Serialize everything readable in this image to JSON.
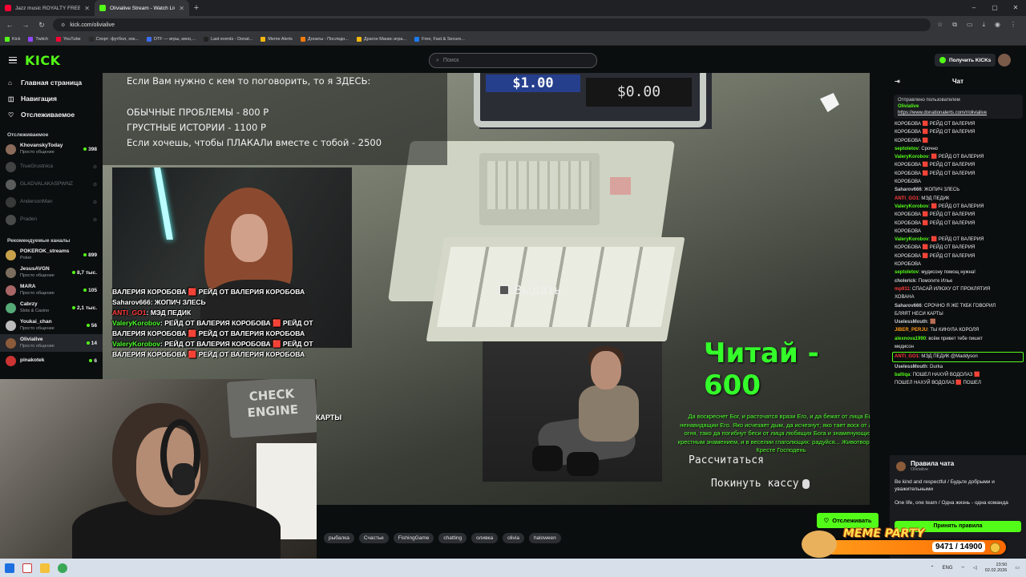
{
  "browser": {
    "tabs": [
      {
        "title": "Jazz music ROYALTY FREE Backg...",
        "color": "#ff0033",
        "active": false
      },
      {
        "title": "Olivialive Stream - Watch Live o...",
        "color": "#53fc18",
        "active": true
      }
    ],
    "new_tab": "+",
    "window_controls": [
      "–",
      "▢",
      "✕"
    ],
    "url": "kick.com/olivialive",
    "bookmarks": [
      {
        "label": "Kick",
        "color": "#53fc18"
      },
      {
        "label": "Twitch",
        "color": "#9146ff"
      },
      {
        "label": "YouTube",
        "color": "#ff0033"
      },
      {
        "label": "Спорт: футбол, хок...",
        "color": "#2a2a2a"
      },
      {
        "label": "DTF — игры, кино,...",
        "color": "#3b6df0"
      },
      {
        "label": "Last events - Donat...",
        "color": "#222"
      },
      {
        "label": "Meme Alerts",
        "color": "#f3b70b"
      },
      {
        "label": "Донаты - Последн...",
        "color": "#f57a0a"
      },
      {
        "label": "Драгон Манис игра...",
        "color": "#f3b70b"
      },
      {
        "label": "Free, Fast & Secure...",
        "color": "#1d7af3"
      }
    ]
  },
  "kick": {
    "logo": "KICK",
    "search_placeholder": "Поиск",
    "get_kicks": "Получить KICKs"
  },
  "sidebar": {
    "nav": [
      {
        "label": "Главная страница",
        "icon": "⌂"
      },
      {
        "label": "Навигация",
        "icon": "◫"
      },
      {
        "label": "Отслеживаемое",
        "icon": "♡"
      }
    ],
    "following_title": "Отслеживаемое",
    "following": [
      {
        "name": "KhovanskyToday",
        "category": "Просто общение",
        "viewers": "398",
        "online": true,
        "color": "#8a6a5a"
      },
      {
        "name": "TrueGrustnica",
        "category": "",
        "viewers": "",
        "online": false,
        "color": "#777"
      },
      {
        "name": "GLADVALAKASPWNZ",
        "category": "",
        "viewers": "",
        "online": false,
        "color": "#aaa"
      },
      {
        "name": "AndersonMan",
        "category": "",
        "viewers": "",
        "online": false,
        "color": "#666"
      },
      {
        "name": "Praden",
        "category": "",
        "viewers": "",
        "online": false,
        "color": "#888"
      }
    ],
    "recommended_title": "Рекомендуемые каналы",
    "recommended": [
      {
        "name": "POKEROK_streams",
        "category": "Poker",
        "viewers": "899",
        "color": "#c9a14a",
        "selected": false
      },
      {
        "name": "JesusAVGN",
        "category": "Просто общение",
        "viewers": "8,7 тыс.",
        "color": "#7b6d5f",
        "selected": false
      },
      {
        "name": "MARA",
        "category": "Просто общение",
        "viewers": "105",
        "color": "#a66",
        "selected": false
      },
      {
        "name": "Cabrzy",
        "category": "Slots & Casino",
        "viewers": "2,1 тыс.",
        "color": "#5a7",
        "selected": false
      },
      {
        "name": "Youkai_chan",
        "category": "Просто общение",
        "viewers": "56",
        "color": "#bbb",
        "selected": false
      },
      {
        "name": "Olivialive",
        "category": "Просто общение",
        "viewers": "14",
        "color": "#8b5b3a",
        "selected": true
      },
      {
        "name": "pinakotek",
        "category": "",
        "viewers": "6",
        "color": "#c33",
        "selected": false
      }
    ]
  },
  "video": {
    "top_lines": [
      "Если Вам нужно с кем то поговорить, то я ЗДЕСЬ:",
      "ОБЫЧНЫЕ ПРОБЛЕМЫ - 800 Р",
      "ГРУСТНЫЕ ИСТОРИИ - 1100 Р",
      "Если хочешь, чтобы ПЛАКАЛи вместе с тобой - 2500"
    ],
    "screen_left": "$1.00",
    "screen_right": "$0.00",
    "give_label": "Выдать",
    "read_price": "Читай - 600",
    "prayer": "Да воскреснет Бог, и расточатся врази Его, и да бежат от лица Его ненавидящии Его. Яко исчезает дым, да исчезнут; яко тает воск от лица огня, тако да погибнут беси от лица любящих Бога и знаменующихся крестным знамением, и в веселии глаголющих: радуйся... Животворящий Кресте Господень",
    "pay_label": "Рассчитаться",
    "leave_label": "Покинуть кассу",
    "cards_label": "КАРТЫ",
    "webcam_sign": "CHECK ENGINE",
    "chat_overlay": [
      {
        "user": "",
        "text": "ВАЛЕРИЯ КОРОБОВА 🟥 РЕЙД ОТ ВАЛЕРИЯ КОРОБОВА"
      },
      {
        "user": "Saharov666",
        "text": ": ЖОПИЧ ЗЛЕСЬ"
      },
      {
        "user": "ANTI_GO1",
        "text": ": МЭД ПЕДИК"
      },
      {
        "user": "ValeryKorobov",
        "text": ": РЕЙД ОТ ВАЛЕРИЯ КОРОБОВА 🟥 РЕЙД ОТ"
      },
      {
        "user": "",
        "text": "ВАЛЕРИЯ КОРОБОВА 🟥 РЕЙД ОТ ВАЛЕРИЯ КОРОБОВА"
      },
      {
        "user": "ValeryKorobov",
        "text": ": РЕЙД ОТ ВАЛЕРИЯ КОРОБОВА 🟥 РЕЙД ОТ"
      },
      {
        "user": "",
        "text": "ВАЛЕРИЯ КОРОБОВА 🟥 РЕЙД ОТ ВАЛЕРИЯ КОРОБОВА"
      }
    ]
  },
  "follow_button": "Отслеживать",
  "tags": [
    "рыбалка",
    "Счастье",
    "FishingGame",
    "chatting",
    "оливка",
    "olivia",
    "haloween"
  ],
  "chat": {
    "title": "Чат",
    "pinned": {
      "label": "Отправлено пользователем",
      "user": "Olivialive",
      "link": "https://www.donationalerts.com/r/olivialive"
    },
    "messages": [
      {
        "user": "",
        "color": "#e8e8e8",
        "text": "КОРОБОВА 🟥 РЕЙД ОТ ВАЛЕРИЯ"
      },
      {
        "user": "",
        "color": "#e8e8e8",
        "text": "КОРОБОВА 🟥 РЕЙД ОТ ВАЛЕРИЯ"
      },
      {
        "user": "",
        "color": "#e8e8e8",
        "text": "КОРОБОВА 🟥"
      },
      {
        "user": "septoletov",
        "color": "#53fc18",
        "text": "Срочно"
      },
      {
        "user": "ValeryKorobov",
        "color": "#53fc18",
        "text": "🟥 РЕЙД ОТ ВАЛЕРИЯ"
      },
      {
        "user": "",
        "color": "#e8e8e8",
        "text": "КОРОБОВА 🟥 РЕЙД ОТ ВАЛЕРИЯ"
      },
      {
        "user": "",
        "color": "#e8e8e8",
        "text": "КОРОБОВА 🟥 РЕЙД ОТ ВАЛЕРИЯ"
      },
      {
        "user": "",
        "color": "#e8e8e8",
        "text": "КОРОБОВА"
      },
      {
        "user": "Saharov666",
        "color": "#cfd1d4",
        "text": "ЖОПИЧ ЗЛЕСЬ"
      },
      {
        "user": "ANTI_GO1",
        "color": "#ff3b3b",
        "text": "МЭД ПЕДИК"
      },
      {
        "user": "ValeryKorobov",
        "color": "#53fc18",
        "text": "🟥 РЕЙД ОТ ВАЛЕРИЯ"
      },
      {
        "user": "",
        "color": "#e8e8e8",
        "text": "КОРОБОВА 🟥 РЕЙД ОТ ВАЛЕРИЯ"
      },
      {
        "user": "",
        "color": "#e8e8e8",
        "text": "КОРОБОВА 🟥 РЕЙД ОТ ВАЛЕРИЯ"
      },
      {
        "user": "",
        "color": "#e8e8e8",
        "text": "КОРОБОВА"
      },
      {
        "user": "ValeryKorobov",
        "color": "#53fc18",
        "text": "🟥 РЕЙД ОТ ВАЛЕРИЯ"
      },
      {
        "user": "",
        "color": "#e8e8e8",
        "text": "КОРОБОВА 🟥 РЕЙД ОТ ВАЛЕРИЯ"
      },
      {
        "user": "",
        "color": "#e8e8e8",
        "text": "КОРОБОВА 🟥 РЕЙД ОТ ВАЛЕРИЯ"
      },
      {
        "user": "",
        "color": "#e8e8e8",
        "text": "КОРОБОВА"
      },
      {
        "user": "septoletov",
        "color": "#53fc18",
        "text": "мудисону помощ нужна!"
      },
      {
        "user": "cholerick",
        "color": "#cfd1d4",
        "text": "Помогите Илье"
      },
      {
        "user": "mp911",
        "color": "#ff3b3b",
        "text": "СПАСАЙ ИЛЮХУ ОТ ПРОКЛЯТИЯ"
      },
      {
        "user": "",
        "color": "#e8e8e8",
        "text": "ХОВАНА"
      },
      {
        "user": "Saharov666",
        "color": "#cfd1d4",
        "text": "СРОЧНО Я ЖЕ ТКБК ГОВОРИЛ"
      },
      {
        "user": "",
        "color": "#e8e8e8",
        "text": "БЛЯЯТ НЕСИ КАРТЫ"
      },
      {
        "user": "UselessMouth",
        "color": "#cfd1d4",
        "text": "🟫"
      },
      {
        "user": "JIBER_PERJU",
        "color": "#ff9a1a",
        "text": "ТЫ КИНУЛА КОРОЛЯ"
      },
      {
        "user": "alexnova1990",
        "color": "#53fc18",
        "text": "всём привет тебе пишет"
      },
      {
        "user": "",
        "color": "#e8e8e8",
        "text": "медисон"
      },
      {
        "user": "ANTI_GO1",
        "color": "#ff3b3b",
        "text": "МЭД ПЕДИК @Maddyson",
        "highlight": true
      },
      {
        "user": "UselessMouth",
        "color": "#cfd1d4",
        "text": "Durka"
      },
      {
        "user": "baltiqa",
        "color": "#53fc18",
        "text": "ПОШЕЛ НАХУЙ ВОДОЛАЗ 🟥"
      },
      {
        "user": "",
        "color": "#e8e8e8",
        "text": "ПОШЕЛ НАХУЙ ВОДОЛАЗ 🟥 ПОШЕЛ"
      }
    ],
    "rules": {
      "title": "Правила чата",
      "sub": "Olivialive",
      "lines": [
        "Be kind and respectful / Будьте добрыми и уважительными",
        "One life, one team / Одна жизнь - одна команда"
      ],
      "accept": "Принять правила"
    }
  },
  "meme_party": {
    "title": "MEME PARTY",
    "count": "9471 / 14900"
  },
  "taskbar": {
    "lang": "ENG",
    "time": "23:50",
    "date": "02.02.2026"
  }
}
